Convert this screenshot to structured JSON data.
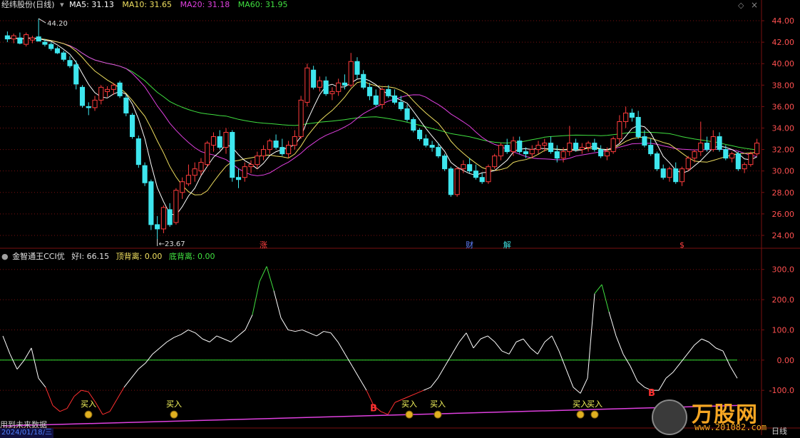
{
  "main_header": {
    "title": "经纬股份(日线)",
    "ma5_label": "MA5: 31.13",
    "ma10_label": "MA10: 31.65",
    "ma20_label": "MA20: 31.18",
    "ma60_label": "MA60: 31.95"
  },
  "sub_header": {
    "title": "金智通王CCI优",
    "hao_label": "好I: 66.15",
    "top_div_label": "顶背离: 0.00",
    "bottom_div_label": "底背离: 0.00"
  },
  "bottom_bar": {
    "left_text": "用到未来数据",
    "date_text": "2024/01/18/三",
    "right_text": "日线"
  },
  "watermark": {
    "brand": "万股网",
    "url": "www.201082.com"
  },
  "colors": {
    "up": "#ff3c3c",
    "down": "#3ee6ee",
    "ma5": "#ffffff",
    "ma10": "#f0e060",
    "ma20": "#e040e0",
    "ma60": "#40e040",
    "grid": "#7a1010"
  },
  "chart_data": [
    {
      "type": "candlestick",
      "title": "经纬股份(日线)",
      "ylim": [
        23,
        45
      ],
      "y_ticks": [
        "24.00",
        "26.00",
        "28.00",
        "30.00",
        "32.00",
        "34.00",
        "36.00",
        "38.00",
        "40.00",
        "42.00",
        "44.00"
      ],
      "annotations": {
        "high_label": "44.20",
        "low_label": "23.67"
      },
      "event_labels": [
        {
          "label": "涨",
          "at": 41
        },
        {
          "label": "财",
          "at": 74
        },
        {
          "label": "解",
          "at": 80
        },
        {
          "label": "$",
          "at": 108
        }
      ],
      "bars": [
        [
          42.6,
          43.0,
          42.0,
          42.3
        ],
        [
          42.3,
          42.8,
          41.9,
          42.6
        ],
        [
          42.4,
          42.9,
          41.8,
          41.9
        ],
        [
          41.8,
          42.9,
          41.6,
          42.7
        ],
        [
          42.2,
          42.6,
          41.9,
          42.4
        ],
        [
          42.5,
          44.2,
          42.2,
          42.1
        ],
        [
          42.0,
          42.3,
          41.6,
          41.8
        ],
        [
          41.8,
          42.0,
          41.2,
          41.4
        ],
        [
          41.4,
          41.6,
          40.9,
          41.0
        ],
        [
          41.0,
          41.2,
          40.2,
          40.4
        ],
        [
          40.3,
          40.7,
          39.6,
          39.8
        ],
        [
          39.9,
          40.3,
          37.6,
          38.1
        ],
        [
          37.8,
          38.0,
          35.9,
          36.1
        ],
        [
          36.0,
          36.4,
          35.2,
          35.9
        ],
        [
          35.9,
          37.0,
          35.6,
          36.6
        ],
        [
          36.6,
          38.0,
          36.2,
          37.8
        ],
        [
          37.4,
          37.9,
          36.9,
          37.6
        ],
        [
          37.6,
          38.2,
          37.1,
          38.0
        ],
        [
          38.2,
          38.4,
          36.8,
          37.0
        ],
        [
          36.8,
          37.1,
          35.1,
          35.4
        ],
        [
          35.2,
          35.4,
          33.0,
          33.2
        ],
        [
          33.0,
          33.3,
          30.3,
          30.6
        ],
        [
          30.5,
          30.8,
          28.6,
          28.9
        ],
        [
          29.0,
          29.2,
          24.5,
          25.0
        ],
        [
          25.0,
          25.8,
          23.67,
          24.6
        ],
        [
          24.6,
          26.8,
          24.2,
          26.6
        ],
        [
          26.4,
          27.0,
          24.8,
          25.0
        ],
        [
          25.2,
          28.4,
          25.0,
          28.2
        ],
        [
          28.0,
          29.4,
          27.4,
          29.0
        ],
        [
          28.8,
          30.6,
          28.6,
          29.6
        ],
        [
          29.6,
          30.8,
          29.0,
          30.2
        ],
        [
          30.0,
          31.2,
          29.6,
          30.8
        ],
        [
          30.6,
          32.8,
          30.4,
          32.6
        ],
        [
          32.4,
          33.6,
          31.8,
          33.2
        ],
        [
          33.2,
          33.8,
          32.0,
          32.2
        ],
        [
          32.2,
          34.0,
          31.6,
          33.6
        ],
        [
          33.6,
          33.8,
          29.0,
          29.4
        ],
        [
          29.4,
          30.2,
          28.4,
          29.2
        ],
        [
          29.4,
          30.8,
          29.0,
          30.4
        ],
        [
          30.4,
          31.0,
          29.8,
          30.6
        ],
        [
          30.6,
          31.8,
          30.2,
          31.4
        ],
        [
          31.4,
          32.4,
          31.0,
          32.0
        ],
        [
          32.0,
          33.0,
          31.6,
          32.8
        ],
        [
          32.8,
          33.4,
          32.0,
          32.2
        ],
        [
          32.2,
          33.0,
          31.4,
          31.6
        ],
        [
          31.6,
          32.8,
          31.2,
          32.4
        ],
        [
          32.4,
          33.8,
          32.0,
          33.2
        ],
        [
          33.2,
          37.0,
          33.0,
          36.6
        ],
        [
          36.4,
          40.0,
          36.0,
          39.6
        ],
        [
          39.4,
          39.8,
          37.6,
          37.8
        ],
        [
          37.8,
          38.8,
          37.4,
          38.4
        ],
        [
          38.4,
          38.8,
          37.0,
          37.2
        ],
        [
          37.2,
          37.8,
          36.6,
          37.4
        ],
        [
          37.4,
          38.6,
          37.0,
          38.2
        ],
        [
          38.2,
          39.0,
          37.6,
          38.0
        ],
        [
          38.0,
          41.0,
          37.8,
          40.2
        ],
        [
          40.2,
          40.6,
          38.6,
          39.0
        ],
        [
          39.0,
          39.4,
          37.6,
          37.8
        ],
        [
          37.8,
          38.2,
          36.6,
          37.0
        ],
        [
          37.0,
          37.6,
          36.0,
          36.2
        ],
        [
          36.2,
          37.8,
          35.8,
          37.6
        ],
        [
          37.6,
          38.0,
          36.8,
          37.0
        ],
        [
          37.0,
          37.6,
          36.2,
          36.4
        ],
        [
          36.4,
          37.0,
          35.6,
          35.8
        ],
        [
          35.8,
          36.2,
          34.6,
          34.8
        ],
        [
          34.8,
          35.0,
          33.6,
          33.8
        ],
        [
          33.8,
          34.0,
          32.8,
          33.0
        ],
        [
          33.0,
          33.4,
          32.2,
          32.4
        ],
        [
          32.4,
          32.8,
          31.8,
          32.2
        ],
        [
          32.2,
          32.6,
          31.2,
          31.4
        ],
        [
          31.4,
          31.6,
          30.0,
          30.2
        ],
        [
          30.2,
          30.4,
          27.6,
          27.8
        ],
        [
          27.8,
          30.4,
          27.6,
          30.2
        ],
        [
          30.2,
          31.0,
          29.8,
          30.6
        ],
        [
          30.6,
          31.2,
          29.8,
          30.0
        ],
        [
          30.0,
          30.6,
          29.2,
          29.4
        ],
        [
          29.4,
          29.8,
          28.8,
          29.0
        ],
        [
          29.0,
          30.6,
          28.8,
          30.4
        ],
        [
          30.4,
          31.6,
          30.2,
          31.4
        ],
        [
          31.4,
          32.6,
          31.0,
          32.4
        ],
        [
          32.4,
          33.0,
          31.6,
          31.8
        ],
        [
          31.8,
          33.2,
          31.4,
          32.8
        ],
        [
          32.8,
          33.2,
          31.6,
          31.8
        ],
        [
          31.8,
          32.2,
          31.2,
          31.6
        ],
        [
          31.6,
          32.4,
          31.2,
          32.0
        ],
        [
          32.0,
          32.8,
          31.6,
          32.4
        ],
        [
          32.4,
          33.0,
          31.8,
          32.6
        ],
        [
          32.6,
          33.2,
          31.6,
          31.8
        ],
        [
          31.8,
          32.4,
          30.8,
          31.2
        ],
        [
          31.2,
          32.2,
          30.8,
          31.8
        ],
        [
          31.8,
          34.2,
          31.4,
          32.6
        ],
        [
          32.6,
          33.0,
          31.8,
          32.0
        ],
        [
          32.0,
          32.6,
          31.6,
          32.2
        ],
        [
          32.2,
          32.8,
          31.8,
          32.6
        ],
        [
          32.6,
          33.0,
          31.8,
          32.0
        ],
        [
          32.0,
          32.4,
          31.2,
          31.4
        ],
        [
          31.4,
          32.2,
          31.0,
          31.8
        ],
        [
          31.8,
          33.2,
          31.6,
          33.0
        ],
        [
          33.0,
          35.2,
          32.6,
          34.6
        ],
        [
          34.6,
          36.0,
          34.0,
          35.4
        ],
        [
          35.4,
          35.8,
          34.6,
          35.0
        ],
        [
          35.0,
          35.6,
          33.0,
          33.2
        ],
        [
          33.2,
          33.8,
          32.2,
          32.4
        ],
        [
          32.4,
          33.0,
          31.4,
          31.6
        ],
        [
          31.6,
          31.8,
          30.0,
          30.2
        ],
        [
          30.2,
          30.6,
          29.2,
          29.4
        ],
        [
          29.4,
          30.4,
          29.0,
          30.2
        ],
        [
          30.2,
          30.8,
          28.8,
          29.0
        ],
        [
          29.0,
          30.4,
          28.6,
          30.2
        ],
        [
          30.2,
          31.4,
          30.0,
          31.2
        ],
        [
          31.2,
          32.0,
          30.8,
          31.8
        ],
        [
          31.8,
          34.6,
          31.4,
          32.6
        ],
        [
          32.6,
          33.2,
          31.8,
          32.0
        ],
        [
          32.0,
          33.8,
          31.8,
          33.2
        ],
        [
          33.2,
          33.6,
          31.8,
          32.0
        ],
        [
          32.0,
          32.4,
          31.0,
          31.2
        ],
        [
          31.2,
          31.8,
          30.8,
          31.6
        ],
        [
          31.6,
          31.8,
          30.0,
          30.2
        ],
        [
          30.2,
          30.8,
          29.8,
          30.6
        ],
        [
          30.6,
          31.8,
          30.4,
          31.6
        ],
        [
          31.6,
          33.0,
          31.4,
          32.6
        ]
      ]
    },
    {
      "type": "line",
      "title": "金智通王CCI优",
      "ylim": [
        -220,
        330
      ],
      "y_ticks": [
        "300.0",
        "200.0",
        "100.0",
        "0.00",
        "-100.0"
      ],
      "cci": [
        80,
        20,
        -30,
        0,
        40,
        -60,
        -90,
        -150,
        -170,
        -160,
        -120,
        -100,
        -105,
        -140,
        -180,
        -170,
        -130,
        -90,
        -60,
        -30,
        -10,
        20,
        40,
        60,
        75,
        85,
        100,
        90,
        70,
        60,
        80,
        70,
        60,
        80,
        100,
        150,
        260,
        310,
        230,
        140,
        100,
        95,
        100,
        90,
        80,
        95,
        90,
        60,
        20,
        -20,
        -60,
        -100,
        -150,
        -170,
        -180,
        -140,
        -130,
        -120,
        -110,
        -100,
        -90,
        -60,
        -20,
        20,
        60,
        90,
        40,
        70,
        80,
        60,
        30,
        20,
        60,
        70,
        40,
        20,
        60,
        80,
        30,
        -30,
        -90,
        -110,
        -60,
        220,
        250,
        160,
        80,
        20,
        -20,
        -70,
        -90,
        -100,
        -100,
        -60,
        -40,
        -10,
        20,
        50,
        70,
        60,
        40,
        30,
        -20,
        -60
      ],
      "annotations": [
        {
          "label": "买入",
          "at": 12
        },
        {
          "label": "买入",
          "at": 24
        },
        {
          "label": "B",
          "at": 52
        },
        {
          "label": "买入",
          "at": 57
        },
        {
          "label": "买入",
          "at": 61
        },
        {
          "label": "买入",
          "at": 81
        },
        {
          "label": "买入",
          "at": 83
        },
        {
          "label": "B",
          "at": 91
        }
      ]
    }
  ]
}
